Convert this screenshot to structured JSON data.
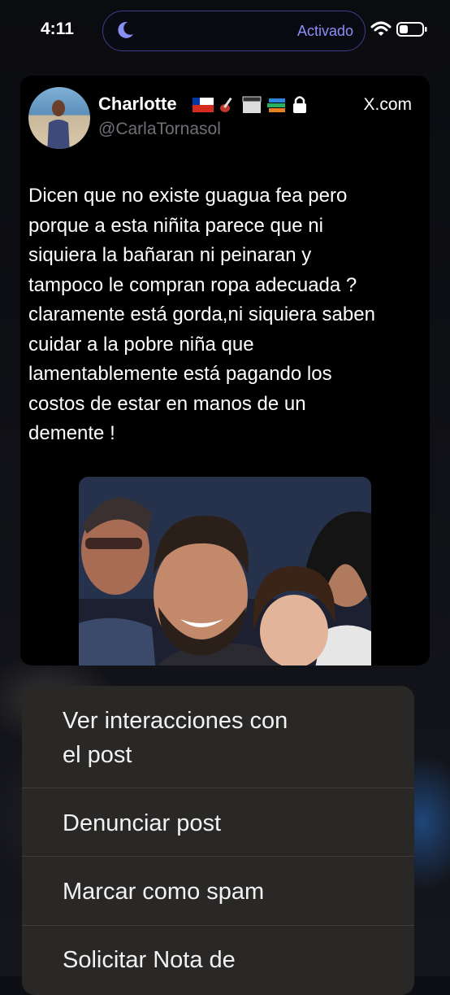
{
  "status_bar": {
    "time": "4:11",
    "focus_label": "Activado",
    "focus_icon": "moon-icon",
    "colors": {
      "focus_accent": "#8a8ff5"
    }
  },
  "tweet": {
    "display_name": "Charlotte",
    "name_emojis": [
      "chile-flag",
      "guitar",
      "clapperboard",
      "books",
      "lock"
    ],
    "handle": "@CarlaTornasol",
    "source": "X.com",
    "text": "Dicen que no existe guagua fea pero\nporque a esta niñita parece que ni\nsiquiera la bañaran ni peinaran y\ntampoco le compran ropa adecuada ?\nclaramente está gorda,ni siquiera saben\ncuidar a la pobre niña que\nlamentablemente está pagando los\ncostos de estar en manos de un\ndemente !"
  },
  "context_menu": {
    "items": [
      {
        "label": "Ver interacciones con\nel post"
      },
      {
        "label": "Denunciar post"
      },
      {
        "label": "Marcar como spam"
      },
      {
        "label": "Solicitar Nota de"
      }
    ]
  }
}
